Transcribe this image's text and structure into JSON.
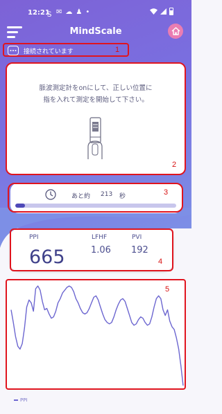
{
  "status_bar": {
    "time": "12:21",
    "icons": [
      "s-icon",
      "mail-icon",
      "cloud-icon",
      "person-icon",
      "dot-icon"
    ],
    "right_icons": [
      "wifi-icon",
      "signal-icon",
      "battery-icon"
    ]
  },
  "header": {
    "title": "MindScale"
  },
  "connection": {
    "status_text": "接続されています"
  },
  "instruction": {
    "line1": "脈波測定計をonにして、正しい位置に",
    "line2": "指を入れて測定を開始して下さい。"
  },
  "timer": {
    "prefix": "あと約",
    "seconds": "213",
    "unit": "秒",
    "progress": 0.06
  },
  "metrics": {
    "ppi_label": "PPI",
    "ppi_value": "665",
    "lfhf_label": "LFHF",
    "lfhf_value": "1.06",
    "pvi_label": "PVI",
    "pvi_value": "192"
  },
  "chart_data": {
    "type": "line",
    "title": "",
    "xlabel": "",
    "ylabel": "",
    "series": [
      {
        "name": "PPI",
        "values": [
          40,
          58,
          78,
          92,
          96,
          88,
          66,
          36,
          26,
          30,
          42,
          10,
          6,
          12,
          28,
          40,
          38,
          46,
          52,
          50,
          42,
          30,
          24,
          16,
          12,
          8,
          6,
          8,
          14,
          24,
          30,
          38,
          44,
          46,
          44,
          38,
          30,
          22,
          20,
          26,
          36,
          46,
          54,
          58,
          60,
          58,
          50,
          40,
          32,
          26,
          24,
          28,
          38,
          48,
          58,
          62,
          60,
          54,
          50,
          52,
          58,
          62,
          60,
          50,
          36,
          24,
          20,
          24,
          40,
          48,
          40,
          56,
          64,
          68,
          80,
          96,
          120,
          148
        ]
      }
    ],
    "legend": [
      "PPI"
    ],
    "legend_position": "bottom-left",
    "grid": false,
    "color": "#6c66d0"
  },
  "annotations": {
    "box1": "1",
    "box2": "2",
    "box3": "3",
    "box4": "4",
    "box5": "5"
  },
  "colors": {
    "accent": "#7a6fe0",
    "marker_red": "#e0141e",
    "home_pink": "#ea7db2",
    "text_purple": "#4c4e8f"
  }
}
